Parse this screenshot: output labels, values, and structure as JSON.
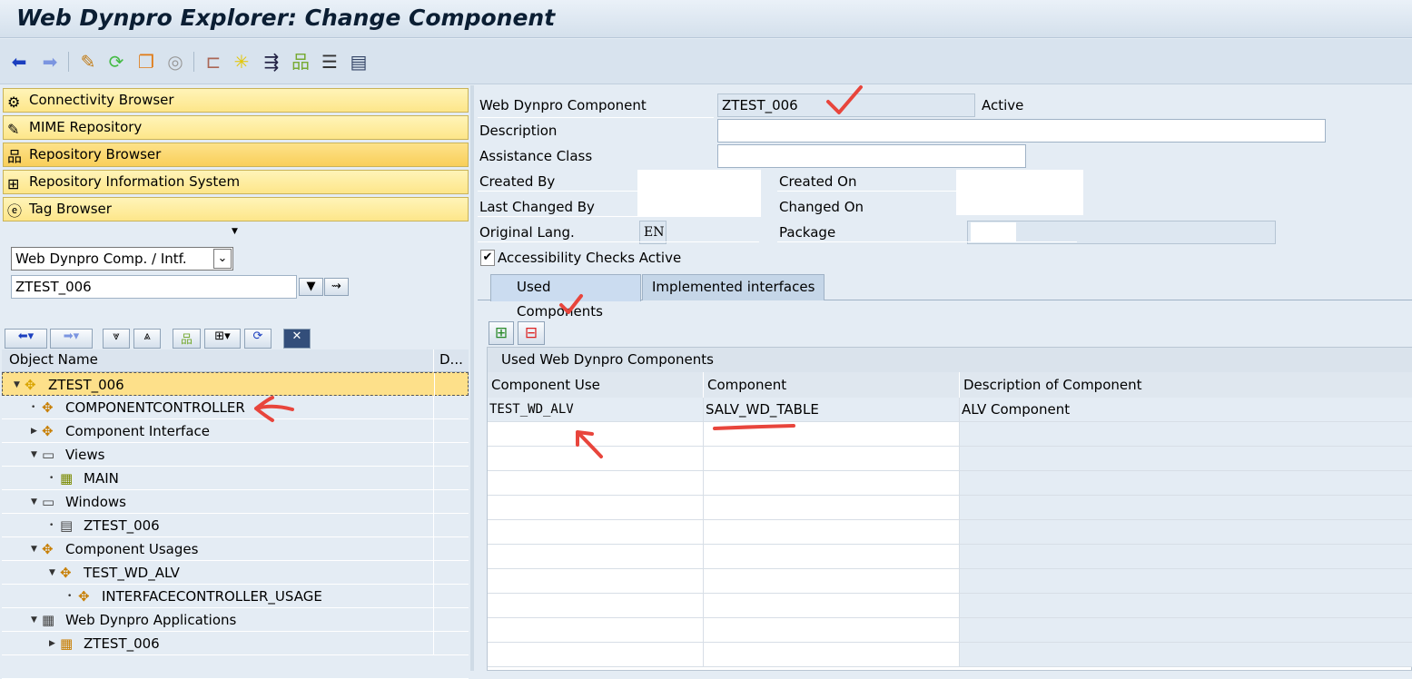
{
  "window": {
    "title": "Web Dynpro Explorer: Change Component"
  },
  "toolbar": {
    "icons": [
      "back-icon",
      "forward-icon",
      "edit-icon",
      "activate-toggle-icon",
      "copy-object-icon",
      "where-used-icon",
      "hierarchy-icon",
      "test-icon",
      "navigate-icon",
      "tree-icon",
      "stack-icon",
      "layout-icon"
    ]
  },
  "nav": {
    "items": [
      {
        "label": "Connectivity Browser",
        "icon": "connectivity-icon"
      },
      {
        "label": "MIME Repository",
        "icon": "mime-icon"
      },
      {
        "label": "Repository Browser",
        "icon": "repository-icon",
        "selected": true
      },
      {
        "label": "Repository Information System",
        "icon": "info-system-icon"
      },
      {
        "label": "Tag Browser",
        "icon": "tag-icon"
      }
    ]
  },
  "browser": {
    "object_type": "Web Dynpro Comp. / Intf.",
    "object_name": "ZTEST_006"
  },
  "tree": {
    "columns": [
      "Object Name",
      "D..."
    ],
    "rows": [
      {
        "label": "ZTEST_006",
        "level": 0,
        "expanded": true,
        "selected": true
      },
      {
        "label": "COMPONENTCONTROLLER",
        "level": 1
      },
      {
        "label": "Component Interface",
        "level": 1,
        "collapsed": true
      },
      {
        "label": "Views",
        "level": 1,
        "expanded": true
      },
      {
        "label": "MAIN",
        "level": 2
      },
      {
        "label": "Windows",
        "level": 1,
        "expanded": true
      },
      {
        "label": "ZTEST_006",
        "level": 2
      },
      {
        "label": "Component Usages",
        "level": 1,
        "expanded": true
      },
      {
        "label": "TEST_WD_ALV",
        "level": 2,
        "expanded": true
      },
      {
        "label": "INTERFACECONTROLLER_USAGE",
        "level": 3
      },
      {
        "label": "Web Dynpro Applications",
        "level": 1,
        "expanded": true
      },
      {
        "label": "ZTEST_006",
        "level": 2,
        "collapsed": true
      }
    ]
  },
  "form": {
    "component_label": "Web Dynpro Component",
    "component_value": "ZTEST_006",
    "status": "Active",
    "description_label": "Description",
    "description_value": "",
    "assistance_label": "Assistance Class",
    "assistance_value": "",
    "created_by_label": "Created By",
    "created_on_label": "Created On",
    "last_changed_by_label": "Last Changed By",
    "changed_on_label": "Changed On",
    "orig_lang_label": "Original Lang.",
    "orig_lang_value": "EN",
    "package_label": "Package",
    "accessibility_label": "Accessibility Checks Active",
    "accessibility_checked": true
  },
  "tabs": [
    {
      "label": "Used Components",
      "active": true
    },
    {
      "label": "Implemented interfaces"
    }
  ],
  "grid": {
    "title": "Used Web Dynpro Components",
    "columns": [
      "Component Use",
      "Component",
      "Description of Component"
    ],
    "rows": [
      [
        "TEST_WD_ALV",
        "SALV_WD_TABLE",
        "ALV Component"
      ]
    ]
  },
  "colors": {
    "annotation": "#e8453c",
    "nav_yellow": "#fde68a",
    "selected": "#fde08a"
  }
}
